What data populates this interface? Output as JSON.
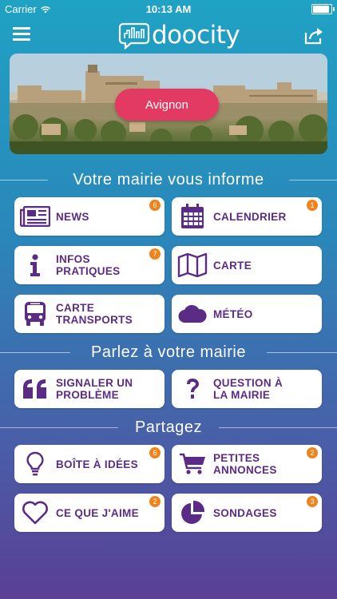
{
  "statusbar": {
    "carrier": "Carrier",
    "time": "10:13 AM"
  },
  "app": {
    "logo_text": "doocity"
  },
  "hero": {
    "city": "Avignon"
  },
  "sections": [
    {
      "title": "Votre mairie vous informe"
    },
    {
      "title": "Parlez à votre mairie"
    },
    {
      "title": "Partagez"
    }
  ],
  "tiles": {
    "news": {
      "label": "NEWS",
      "badge": "6"
    },
    "calendrier": {
      "label": "CALENDRIER",
      "badge": "1"
    },
    "infos": {
      "line1": "INFOS",
      "line2": "PRATIQUES",
      "badge": "7"
    },
    "carte": {
      "label": "CARTE"
    },
    "transports": {
      "line1": "CARTE",
      "line2": "TRANSPORTS"
    },
    "meteo": {
      "label": "MÉTÉO"
    },
    "signaler": {
      "line1": "SIGNALER UN",
      "line2": "PROBLÈME"
    },
    "question": {
      "line1": "QUESTION À",
      "line2": "LA MAIRIE"
    },
    "idees": {
      "label": "BOÎTE À IDÉES",
      "badge": "6"
    },
    "annonces": {
      "line1": "PETITES",
      "line2": "ANNONCES",
      "badge": "2"
    },
    "aime": {
      "label": "CE QUE J'AIME",
      "badge": "2"
    },
    "sondages": {
      "label": "SONDAGES",
      "badge": "3"
    }
  },
  "colors": {
    "accent_purple": "#5b2c86",
    "badge_orange": "#f0841c",
    "pill_pink": "#e33a63"
  }
}
